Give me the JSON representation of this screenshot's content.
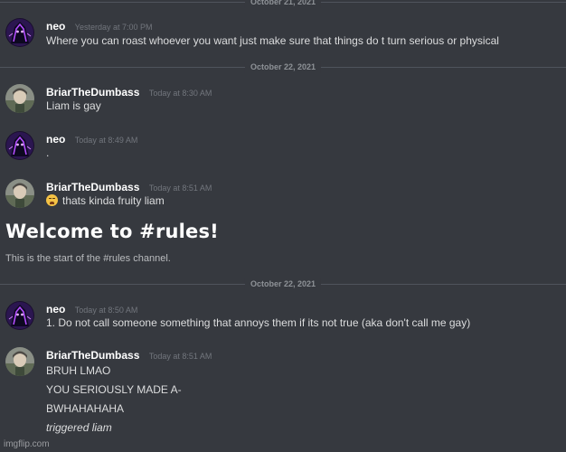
{
  "dividers": [
    {
      "date": "October 21, 2021"
    },
    {
      "date": "October 22, 2021"
    },
    {
      "date": "October 22, 2021"
    }
  ],
  "messages": [
    {
      "author": "neo",
      "timestamp": "Yesterday at 7:00 PM",
      "lines": [
        "Where you can roast whoever you want just make sure that things do t turn serious or physical"
      ]
    },
    {
      "author": "BriarTheDumbass",
      "timestamp": "Today at 8:30 AM",
      "lines": [
        "Liam is gay"
      ]
    },
    {
      "author": "neo",
      "timestamp": "Today at 8:49 AM",
      "lines": [
        "."
      ]
    },
    {
      "author": "BriarTheDumbass",
      "timestamp": "Today at 8:51 AM",
      "emoji": "weary-face-emoji",
      "lines": [
        "thats kinda fruity liam"
      ]
    },
    {
      "author": "neo",
      "timestamp": "Today at 8:50 AM",
      "lines": [
        "1. Do not call someone something that annoys them if its not true (aka don't call me gay)"
      ]
    },
    {
      "author": "BriarTheDumbass",
      "timestamp": "Today at 8:51 AM",
      "lines": [
        "BRUH LMAO",
        "YOU SERIOUSLY MADE A-",
        "BWHAHAHAHA",
        "triggered liam"
      ]
    }
  ],
  "channel_intro": {
    "title": "Welcome to #rules!",
    "subtitle": "This is the start of the #rules channel."
  },
  "watermark": "imgflip.com",
  "colors": {
    "background": "#36393f",
    "author": "#ffffff",
    "text": "#dcddde",
    "timestamp": "#72767d"
  }
}
